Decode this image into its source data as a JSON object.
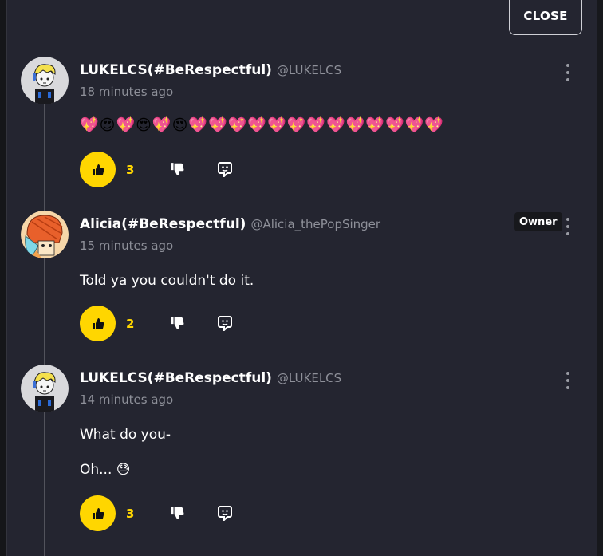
{
  "header": {
    "close_label": "CLOSE"
  },
  "comments": [
    {
      "author": "LUKELCS(#BeRespectful)",
      "handle": "@LUKELCS",
      "time": "18 minutes ago",
      "text": "💖😍💖😍💖😍💖💖💖💖💖💖💖💖💖💖💖💖💖",
      "likes": "3"
    },
    {
      "author": "Alicia(#BeRespectful)",
      "handle": "@Alicia_thePopSinger",
      "time": "15 minutes ago",
      "badge": "Owner",
      "text": "Told ya you couldn't do it.",
      "likes": "2"
    },
    {
      "author": "LUKELCS(#BeRespectful)",
      "handle": "@LUKELCS",
      "time": "14 minutes ago",
      "text_lines": [
        "What do you-",
        "Oh... 😓"
      ],
      "likes": "3"
    }
  ],
  "icons": {
    "like": "thumbs-up-icon",
    "dislike": "thumbs-down-icon",
    "reply": "reply-icon",
    "more": "more-vertical-icon"
  },
  "colors": {
    "accent": "#ffd600",
    "panel": "#242530"
  }
}
